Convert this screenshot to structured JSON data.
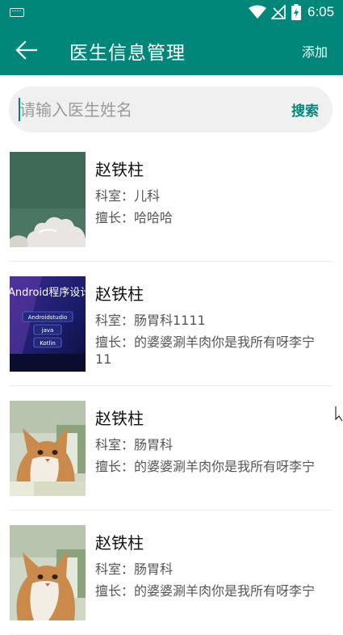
{
  "status_bar": {
    "time": "6:05"
  },
  "app_bar": {
    "title": "医生信息管理",
    "add_label": "添加"
  },
  "search": {
    "placeholder": "请输入医生姓名",
    "value": "",
    "button_label": "搜索"
  },
  "doctors": [
    {
      "name": "赵铁柱",
      "department": "科室：儿科",
      "specialty": "擅长：哈哈哈",
      "photo_icon": "cloud-photo"
    },
    {
      "name": "赵铁柱",
      "department": "科室：肠胃科1111",
      "specialty": "擅长：的婆婆涮羊肉你是我所有呀李宁11",
      "photo_icon": "android-course-photo",
      "photo_text": {
        "title": "Android程序设计",
        "b1": "Androidstudio",
        "b2": "java",
        "b3": "Kotlin"
      }
    },
    {
      "name": "赵铁柱",
      "department": "科室：肠胃科",
      "specialty": "擅长：的婆婆涮羊肉你是我所有呀李宁",
      "photo_icon": "cat-photo"
    },
    {
      "name": "赵铁柱",
      "department": "科室：肠胃科",
      "specialty": "擅长：的婆婆涮羊肉你是我所有呀李宁",
      "photo_icon": "cat-photo"
    }
  ],
  "colors": {
    "primary": "#00877a",
    "search_bg": "#f0f0f0",
    "text_secondary": "#555555"
  }
}
